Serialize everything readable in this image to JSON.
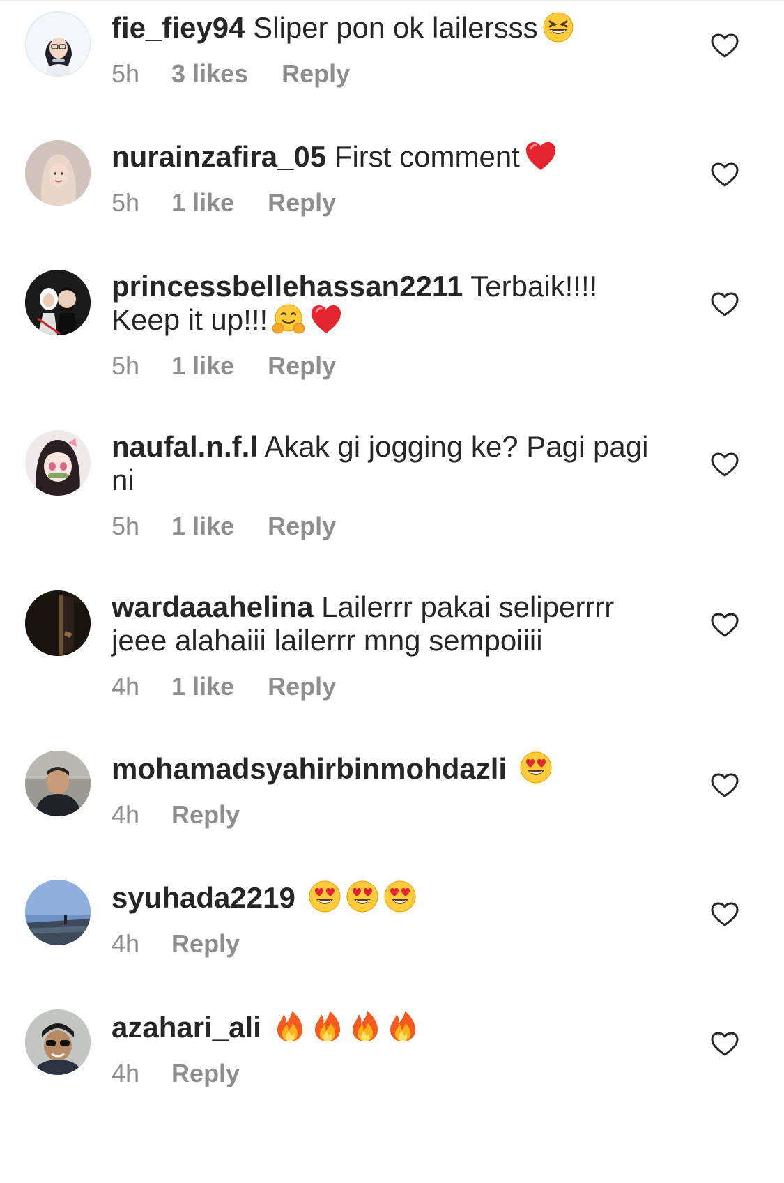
{
  "comments": [
    {
      "username": "fie_fiey94",
      "text": "Sliper pon ok lailersss",
      "emoji_icons": [
        "grinning-squinting-face-icon"
      ],
      "time": "5h",
      "likes": "3 likes",
      "reply": "Reply",
      "avatar_color": "#e6f0f6"
    },
    {
      "username": "nurainzafira_05",
      "text": "First comment",
      "emoji_icons": [
        "red-heart-icon"
      ],
      "time": "5h",
      "likes": "1 like",
      "reply": "Reply",
      "avatar_color": "#d9c7bd"
    },
    {
      "username": "princessbellehassan2211",
      "text": "Terbaik!!!! Keep it up!!!",
      "emoji_icons": [
        "hugging-face-icon",
        "red-heart-icon"
      ],
      "time": "5h",
      "likes": "1 like",
      "reply": "Reply",
      "avatar_color": "#1b1b1b"
    },
    {
      "username": "naufal.n.f.l",
      "text": "Akak gi jogging ke? Pagi pagi ni",
      "emoji_icons": [],
      "time": "5h",
      "likes": "1 like",
      "reply": "Reply",
      "avatar_color": "#e9e4e4"
    },
    {
      "username": "wardaaahelina",
      "text": "Lailerrr pakai seliperrrr jeee alahaiii lailerrr mng sempoiiii",
      "emoji_icons": [],
      "time": "4h",
      "likes": "1 like",
      "reply": "Reply",
      "avatar_color": "#1e1712"
    },
    {
      "username": "mohamadsyahirbinmohdazli",
      "text": "",
      "emoji_icons": [
        "smiling-face-heart-eyes-icon"
      ],
      "time": "4h",
      "likes": "",
      "reply": "Reply",
      "avatar_color": "#8a8a82"
    },
    {
      "username": "syuhada2219",
      "text": "",
      "emoji_icons": [
        "smiling-face-heart-eyes-icon",
        "smiling-face-heart-eyes-icon",
        "smiling-face-heart-eyes-icon"
      ],
      "time": "4h",
      "likes": "",
      "reply": "Reply",
      "avatar_color": "#5f7fae"
    },
    {
      "username": "azahari_ali",
      "text": "",
      "emoji_icons": [
        "fire-icon",
        "fire-icon",
        "fire-icon",
        "fire-icon"
      ],
      "time": "4h",
      "likes": "",
      "reply": "Reply",
      "avatar_color": "#b7b9b6"
    }
  ],
  "colors": {
    "text": "#262626",
    "meta": "#8e8e8e",
    "heart_outline": "#262626"
  }
}
